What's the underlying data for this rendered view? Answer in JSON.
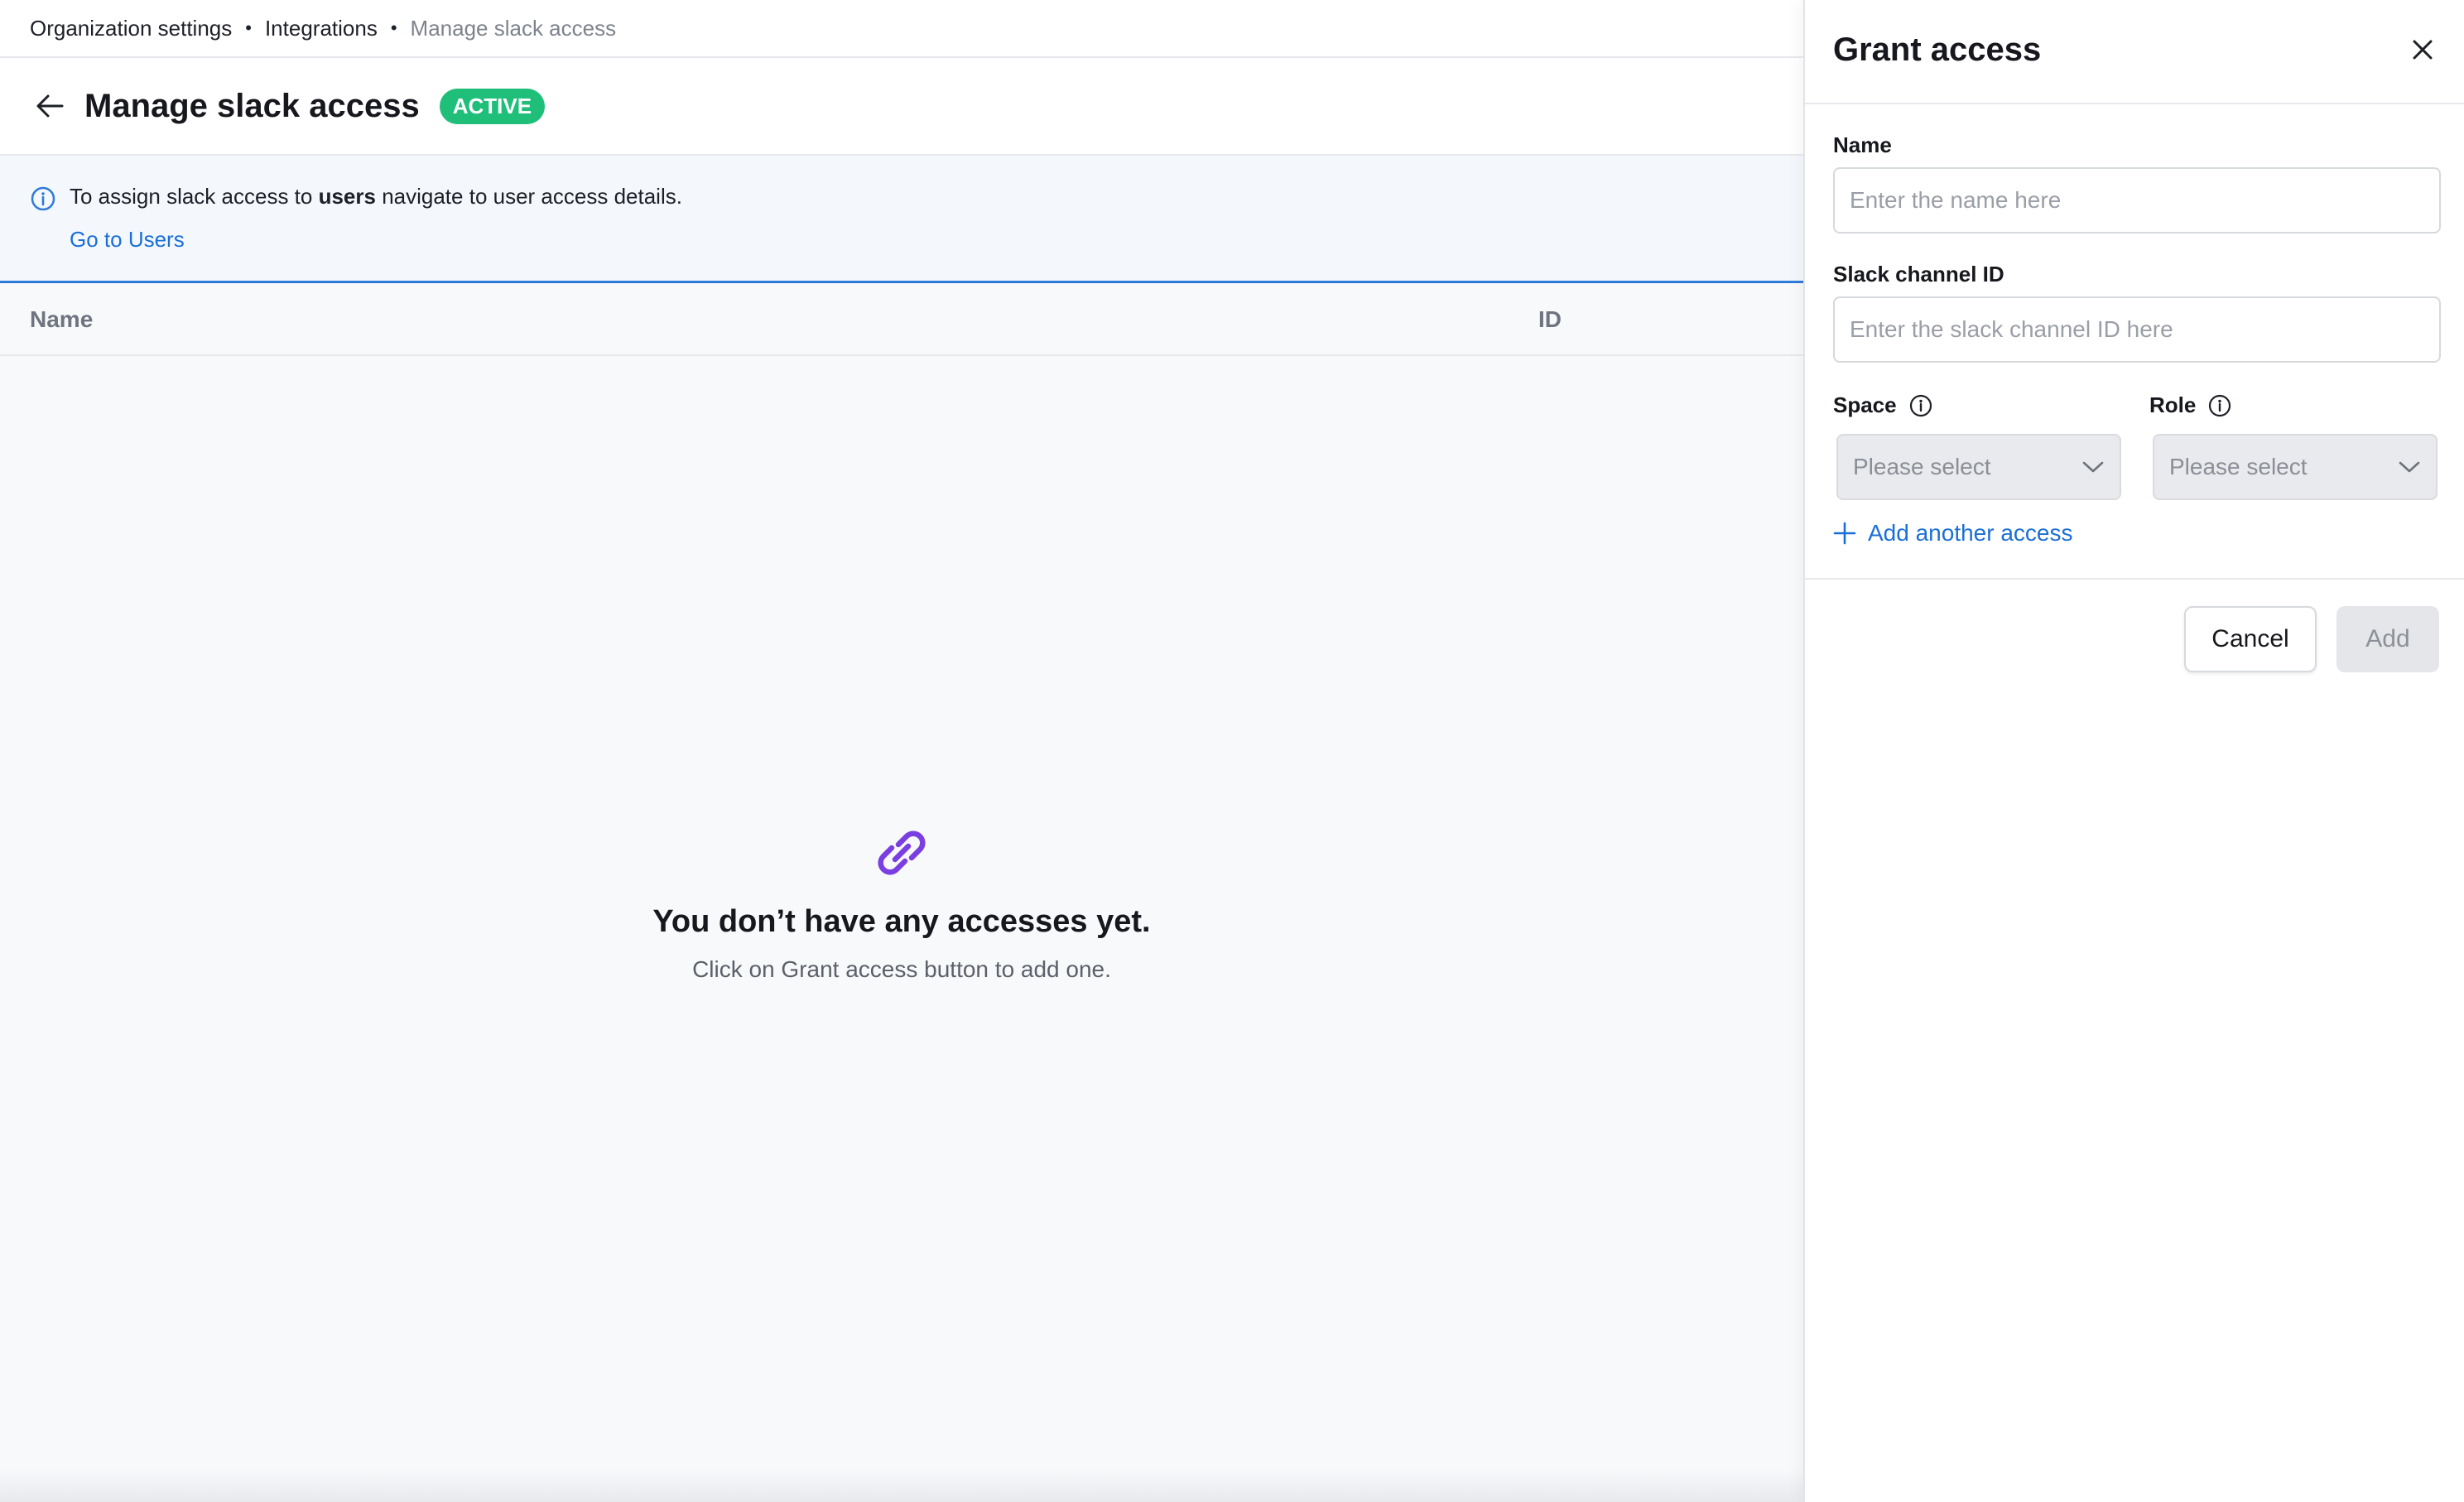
{
  "breadcrumb": {
    "items": [
      "Organization settings",
      "Integrations"
    ],
    "current": "Manage slack access",
    "separator": "•"
  },
  "header": {
    "title": "Manage slack access",
    "status": "ACTIVE"
  },
  "info_banner": {
    "text_before": "To assign slack access to ",
    "text_bold": "users",
    "text_after": " navigate to user access details.",
    "link": "Go to Users"
  },
  "table": {
    "columns": [
      "Name",
      "ID"
    ]
  },
  "empty_state": {
    "title": "You don’t have any accesses yet.",
    "subtitle": "Click on Grant access button to add one."
  },
  "drawer": {
    "title": "Grant access",
    "name_label": "Name",
    "name_placeholder": "Enter the name here",
    "channel_label": "Slack channel ID",
    "channel_placeholder": "Enter the slack channel ID here",
    "space_label": "Space",
    "space_value": "Please select",
    "role_label": "Role",
    "role_value": "Please select",
    "add_another": "Add another access",
    "cancel": "Cancel",
    "add": "Add"
  },
  "colors": {
    "accent": "#1a6fd6",
    "badge": "#1fbf7a",
    "link_icon": "#7a3fe0"
  },
  "icons": [
    "arrow-left-icon",
    "info-icon",
    "link-icon",
    "close-icon",
    "chevron-down-icon",
    "plus-icon"
  ]
}
